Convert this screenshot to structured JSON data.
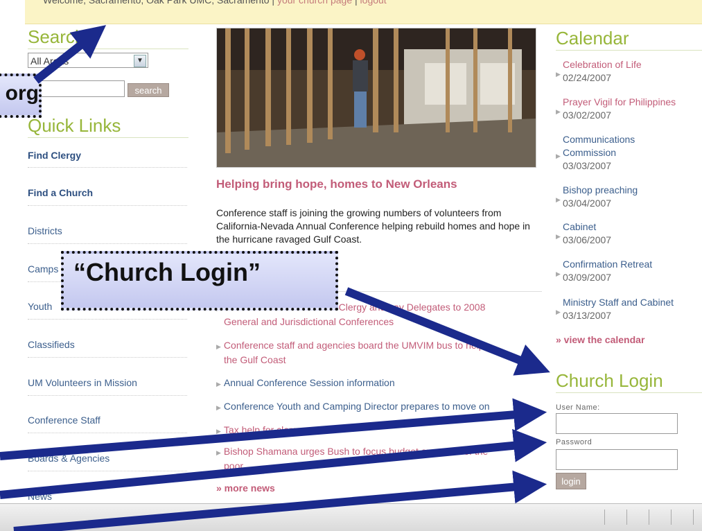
{
  "top_bar": {
    "welcome_text": "Welcome, Sacramento, Oak Park UMC, Sacramento |",
    "church_page_link": "your church page",
    "separator": "|",
    "logout_link": "logout"
  },
  "search": {
    "heading": "Search",
    "area_select_value": "All Areas",
    "button_label": "search"
  },
  "quick_links": {
    "heading": "Quick Links",
    "items": [
      {
        "label": "Find Clergy"
      },
      {
        "label": "Find a Church"
      },
      {
        "label": "Districts"
      },
      {
        "label": "Camps"
      },
      {
        "label": "Youth"
      },
      {
        "label": "Classifieds"
      },
      {
        "label": "UM Volunteers in Mission"
      },
      {
        "label": "Conference Staff"
      },
      {
        "label": "Boards & Agencies"
      },
      {
        "label": "News"
      }
    ]
  },
  "feature": {
    "headline": "Helping bring hope, homes to New Orleans",
    "body": "Conference staff is joining the growing numbers of volunteers from California-Nevada Annual Conference helping rebuild homes and hope in the hurricane ravaged Gulf Coast."
  },
  "news": {
    "items": [
      {
        "line1": "Conference elects slate of Clergy and Lay Delegates to 2008",
        "line2": "General and Jurisdictional Conferences"
      },
      {
        "line1": "Conference staff and agencies board the UMVIM bus to help",
        "line2": "the Gulf Coast"
      },
      {
        "line1": "Annual Conference Session information",
        "line2": ""
      },
      {
        "line1": "Conference Youth and Camping Director prepares to move on",
        "line2": ""
      },
      {
        "line1": "Tax help for clergy",
        "line2": ""
      },
      {
        "line1": "Bishop Shamana urges Bush to focus budget on needs of the",
        "line2": "poor"
      }
    ],
    "more_label": "» more news"
  },
  "calendar": {
    "heading": "Calendar",
    "events": [
      {
        "title": "Celebration of Life",
        "date": "02/24/2007"
      },
      {
        "title": "Prayer Vigil for Philippines",
        "date": "03/02/2007"
      },
      {
        "title": "Communications",
        "title2": "Commission",
        "date": "03/03/2007"
      },
      {
        "title": "Bishop preaching",
        "date": "03/04/2007"
      },
      {
        "title": "Cabinet",
        "date": "03/06/2007"
      },
      {
        "title": "Confirmation Retreat",
        "date": "03/09/2007"
      },
      {
        "title": "Ministry Staff and Cabinet",
        "date": "03/13/2007"
      }
    ],
    "view_label": "» view the calendar"
  },
  "church_login": {
    "heading": "Church Login",
    "username_label": "User Name:",
    "password_label": "Password",
    "button_label": "login"
  },
  "callouts": {
    "login_callout": "“Church Login”",
    "url_fragment": "org"
  },
  "colors": {
    "heading_green": "#97b63a",
    "link_pink": "#c25c78",
    "link_blue": "#3b5e8c",
    "arrow_navy": "#1b2a8c",
    "topbar_yellow": "#fbf4c6"
  }
}
